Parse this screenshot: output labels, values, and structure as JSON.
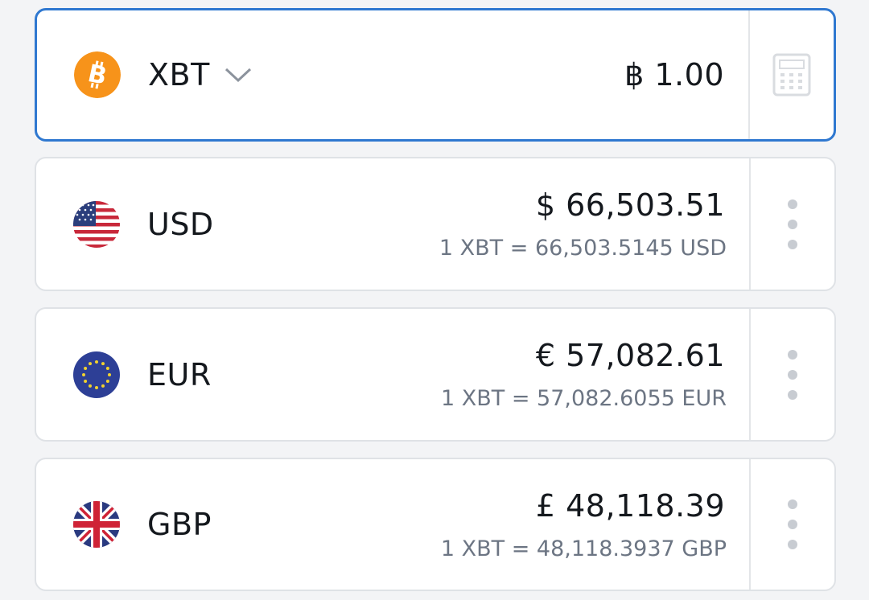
{
  "base": {
    "code": "XBT",
    "amount": "฿ 1.00",
    "icon": "bitcoin-icon",
    "accent": "#2f78d0"
  },
  "conversions": [
    {
      "code": "USD",
      "amount": "$ 66,503.51",
      "rate": "1 XBT = 66,503.5145 USD",
      "icon": "us-flag-icon"
    },
    {
      "code": "EUR",
      "amount": "€ 57,082.61",
      "rate": "1 XBT = 57,082.6055 EUR",
      "icon": "eu-flag-icon"
    },
    {
      "code": "GBP",
      "amount": "£ 48,118.39",
      "rate": "1 XBT = 48,118.3937 GBP",
      "icon": "uk-flag-icon"
    }
  ]
}
